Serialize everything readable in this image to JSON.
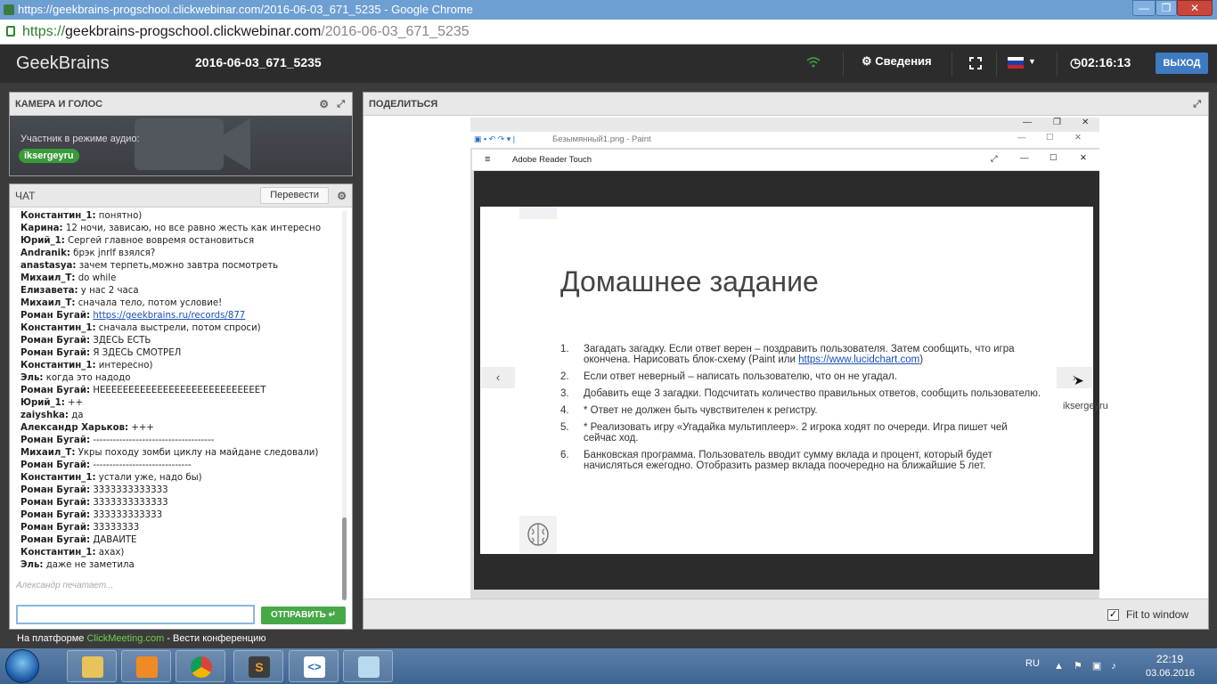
{
  "window": {
    "title": "https://geekbrains-progschool.clickwebinar.com/2016-06-03_671_5235 - Google Chrome",
    "url_scheme": "https://",
    "url_host": "geekbrains-progschool.clickwebinar.com",
    "url_path": "/2016-06-03_671_5235"
  },
  "header": {
    "logo": "GeekBrains",
    "meeting_title": "2016-06-03_671_5235",
    "details_label": "Сведения",
    "timer": "02:16:13",
    "exit_label": "ВЫХОД"
  },
  "camera": {
    "title": "КАМЕРА И ГОЛОС",
    "audio_mode": "Участник в режиме аудио:",
    "user": "iksergeyru"
  },
  "chat": {
    "title": "ЧАТ",
    "translate_label": "Перевести",
    "typing": "Александр печатает...",
    "send_label": "ОТПРАВИТЬ",
    "messages": [
      {
        "nick": "Константин_1:",
        "text": " понятно)"
      },
      {
        "nick": "Карина:",
        "text": " 12 ночи, зависаю, но все равно жесть как интересно"
      },
      {
        "nick": "Юрий_1:",
        "text": " Сергей главное вовремя остановиться"
      },
      {
        "nick": "Andranik:",
        "text": " брэк jnrlf взялся?"
      },
      {
        "nick": "anastasya:",
        "text": " зачем терпеть,можно завтра посмотреть"
      },
      {
        "nick": "Михаил_Т:",
        "text": " do while"
      },
      {
        "nick": "Елизавета:",
        "text": " у нас 2 часа"
      },
      {
        "nick": "Михаил_Т:",
        "text": " сначала тело, потом условие!"
      },
      {
        "nick": "Роман Бугай:",
        "text": " ",
        "link": "https://geekbrains.ru/records/877"
      },
      {
        "nick": "Константин_1:",
        "text": " сначала выстрели, потом спроси)"
      },
      {
        "nick": "Роман Бугай:",
        "text": " ЗДЕСЬ ЕСТЬ"
      },
      {
        "nick": "Роман Бугай:",
        "text": " Я ЗДЕСЬ СМОТРЕЛ"
      },
      {
        "nick": "Константин_1:",
        "text": " интересно)"
      },
      {
        "nick": "Эль:",
        "text": " когда это надодо"
      },
      {
        "nick": "Роман Бугай:",
        "text": " НЕЕЕЕЕЕЕЕЕЕЕЕЕЕЕЕЕЕЕЕЕЕЕЕЕЕЕЕТ"
      },
      {
        "nick": "Юрий_1:",
        "text": " ++"
      },
      {
        "nick": "zaiyshka:",
        "text": " да"
      },
      {
        "nick": "Александр Харьков:",
        "text": " +++"
      },
      {
        "nick": "Роман Бугай:",
        "text": " -------------------------------------"
      },
      {
        "nick": "Михаил_Т:",
        "text": " Укры походу зомби циклу на майдане следовали)"
      },
      {
        "nick": "Роман Бугай:",
        "text": " ------------------------------"
      },
      {
        "nick": "Константин_1:",
        "text": " устали уже, надо бы)"
      },
      {
        "nick": "Роман Бугай:",
        "text": " 3333333333333"
      },
      {
        "nick": "Роман Бугай:",
        "text": " 3333333333333"
      },
      {
        "nick": "Роман Бугай:",
        "text": " 333333333333"
      },
      {
        "nick": "Роман Бугай:",
        "text": " 33333333"
      },
      {
        "nick": "Роман Бугай:",
        "text": " ДАВАЙТЕ"
      },
      {
        "nick": "Константин_1:",
        "text": " ахах)"
      },
      {
        "nick": "Эль:",
        "text": " даже не заметила"
      }
    ]
  },
  "footer": {
    "prefix": "На платформе ",
    "brand": "ClickMeeting.com",
    "suffix": " - Вести конференцию"
  },
  "share": {
    "title": "ПОДЕЛИТЬСЯ",
    "fit_label": "Fit to window",
    "fit_checked": true,
    "paint_title": "Безымянный1.png - Paint",
    "reader_title": "Adobe Reader Touch",
    "slide_title": "Домашнее задание",
    "cursor_user": "iksergeyru",
    "slide_items": [
      {
        "num": "1.",
        "text": "Загадать загадку. Если ответ верен – поздравить пользователя. Затем сообщить, что игра окончена. Нарисовать блок-схему (Paint или ",
        "link": "https://www.lucidchart.com",
        "after": ")"
      },
      {
        "num": "2.",
        "text": "Если ответ неверный – написать пользователю, что он не угадал."
      },
      {
        "num": "3.",
        "text": "Добавить еще 3 загадки. Подсчитать количество правильных ответов, сообщить пользователю."
      },
      {
        "num": "4.",
        "text": "* Ответ не должен быть чувствителен к регистру."
      },
      {
        "num": "5.",
        "text": "* Реализовать игру «Угадайка мультиплеер». 2 игрока ходят по очереди. Игра пишет чей сейчас ход."
      },
      {
        "num": "6.",
        "text": "Банковская программа. Пользователь вводит сумму вклада и процент, который будет начисляться ежегодно. Отобразить размер вклада поочередно на ближайшие 5 лет."
      }
    ]
  },
  "taskbar": {
    "lang": "RU",
    "time": "22:19",
    "date": "03.06.2016"
  }
}
